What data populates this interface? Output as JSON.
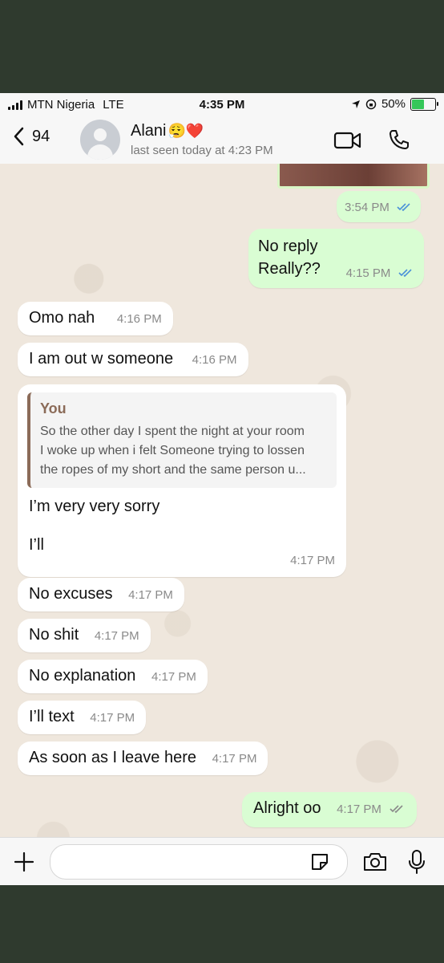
{
  "status_bar": {
    "carrier": "MTN Nigeria",
    "network": "LTE",
    "time": "4:35 PM",
    "battery": "50%"
  },
  "header": {
    "back_count": "94",
    "contact_name": "Alani",
    "contact_emoji": "😮‍💨❤️",
    "last_seen": "last seen today at 4:23 PM"
  },
  "messages": [
    {
      "dir": "out",
      "text": "",
      "time": "3:54 PM",
      "read": true
    },
    {
      "dir": "out",
      "text_line1": "No reply",
      "text_line2": "Really??",
      "time": "4:15 PM",
      "read": true
    },
    {
      "dir": "in",
      "text": "Omo nah",
      "time": "4:16 PM"
    },
    {
      "dir": "in",
      "text": "I am out w someone",
      "time": "4:16 PM"
    },
    {
      "dir": "in",
      "quote_author": "You",
      "quote_line1": "So the other day I spent the night at your room",
      "quote_line2": "I woke up when i felt Someone trying to lossen",
      "quote_line3": "the ropes of my short and the same person u...",
      "text_line1": "I’m very very sorry",
      "text_line2": "I’ll",
      "time": "4:17 PM"
    },
    {
      "dir": "in",
      "text": "No excuses",
      "time": "4:17 PM"
    },
    {
      "dir": "in",
      "text": "No shit",
      "time": "4:17 PM"
    },
    {
      "dir": "in",
      "text": "No explanation",
      "time": "4:17 PM"
    },
    {
      "dir": "in",
      "text": "I’ll text",
      "time": "4:17 PM"
    },
    {
      "dir": "in",
      "text": "As soon as I leave here",
      "time": "4:17 PM"
    },
    {
      "dir": "out",
      "text": "Alright oo",
      "time": "4:17 PM",
      "read": false
    }
  ],
  "input": {
    "placeholder": ""
  },
  "colors": {
    "outgoing": "#d9fdd3",
    "incoming": "#ffffff",
    "read_ticks": "#4a90d9",
    "sent_ticks": "#8a8a8a",
    "wallpaper": "#efe7dd"
  },
  "icons": [
    "chevron-left-icon",
    "video-icon",
    "phone-icon",
    "plus-icon",
    "sticker-icon",
    "camera-icon",
    "microphone-icon",
    "location-icon",
    "orientation-lock-icon"
  ]
}
